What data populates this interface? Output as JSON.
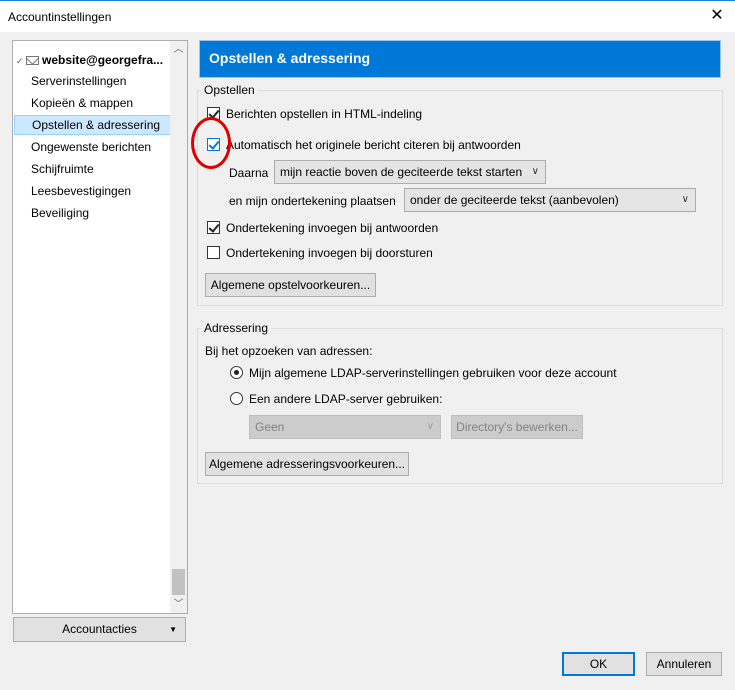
{
  "window": {
    "title": "Accountinstellingen",
    "close_glyph": "✕"
  },
  "sidebar": {
    "account": "website@georgefra...",
    "items": [
      {
        "label": "Serverinstellingen"
      },
      {
        "label": "Kopieën & mappen"
      },
      {
        "label": "Opstellen & adressering"
      },
      {
        "label": "Ongewenste berichten"
      },
      {
        "label": "Schijfruimte"
      },
      {
        "label": "Leesbevestigingen"
      },
      {
        "label": "Beveiliging"
      }
    ],
    "selected_index": 2,
    "account_actions": "Accountacties"
  },
  "main": {
    "heading": "Opstellen & adressering",
    "compose": {
      "legend": "Opstellen",
      "html_compose": {
        "label": "Berichten opstellen in HTML-indeling",
        "checked": true
      },
      "quote_original": {
        "label": "Automatisch het originele bericht citeren bij antwoorden",
        "checked": true
      },
      "then_label": "Daarna",
      "then_value": "mijn reactie boven de geciteerde tekst starten",
      "signature_place_label": "en mijn ondertekening plaatsen",
      "signature_place_value": "onder de geciteerde tekst (aanbevolen)",
      "sig_reply": {
        "label": "Ondertekening invoegen bij antwoorden",
        "checked": true
      },
      "sig_forward": {
        "label": "Ondertekening invoegen bij doorsturen",
        "checked": false
      },
      "prefs_button": "Algemene opstelvoorkeuren..."
    },
    "addressing": {
      "legend": "Adressering",
      "lookup_label": "Bij het opzoeken van adressen:",
      "option_global": {
        "label": "Mijn algemene LDAP-serverinstellingen gebruiken voor deze account",
        "selected": true
      },
      "option_other": {
        "label": "Een andere LDAP-server gebruiken:",
        "selected": false
      },
      "server_value": "Geen",
      "edit_dirs_button": "Directory's bewerken...",
      "prefs_button": "Algemene adresseringsvoorkeuren..."
    }
  },
  "footer": {
    "ok": "OK",
    "cancel": "Annuleren"
  },
  "colors": {
    "accent": "#0078d7",
    "annotation": "#e00000"
  }
}
